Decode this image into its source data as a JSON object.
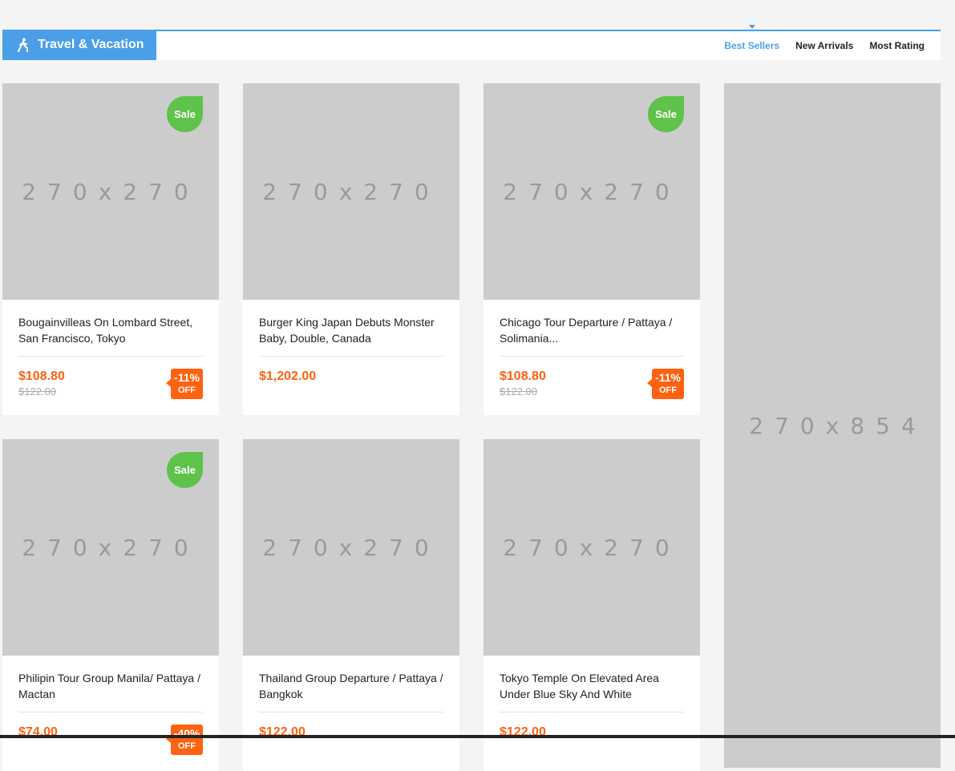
{
  "header": {
    "title": "Travel & Vacation",
    "tabs": [
      "Best Sellers",
      "New Arrivals",
      "Most Rating"
    ],
    "active_tab": "Best Sellers",
    "accent_color": "#4a9fe8"
  },
  "placeholder_label": "270x270",
  "banner_label": "270x854",
  "sale_label": "Sale",
  "off_label": "OFF",
  "products": [
    {
      "name": "Bougainvilleas On Lombard Street, San Francisco, Tokyo",
      "price": "$108.80",
      "old_price": "$122.00",
      "discount": "-11%",
      "sale": true
    },
    {
      "name": "Burger King Japan Debuts Monster Baby, Double, Canada",
      "price": "$1,202.00",
      "old_price": "",
      "discount": "",
      "sale": false
    },
    {
      "name": "Chicago Tour Departure / Pattaya / Solimania...",
      "price": "$108.80",
      "old_price": "$122.00",
      "discount": "-11%",
      "sale": true
    },
    {
      "name": "Philipin Tour Group Manila/ Pattaya / Mactan",
      "price": "$74.00",
      "old_price": "",
      "discount": "-40%",
      "sale": true
    },
    {
      "name": "Thailand Group Departure / Pattaya / Bangkok",
      "price": "$122.00",
      "old_price": "",
      "discount": "",
      "sale": false
    },
    {
      "name": "Tokyo Temple On Elevated Area Under Blue Sky And White",
      "price": "$122.00",
      "old_price": "",
      "discount": "",
      "sale": false
    }
  ],
  "colors": {
    "sale": "#5fc24a",
    "price": "#ff6211",
    "placeholder": "#cccccc"
  }
}
